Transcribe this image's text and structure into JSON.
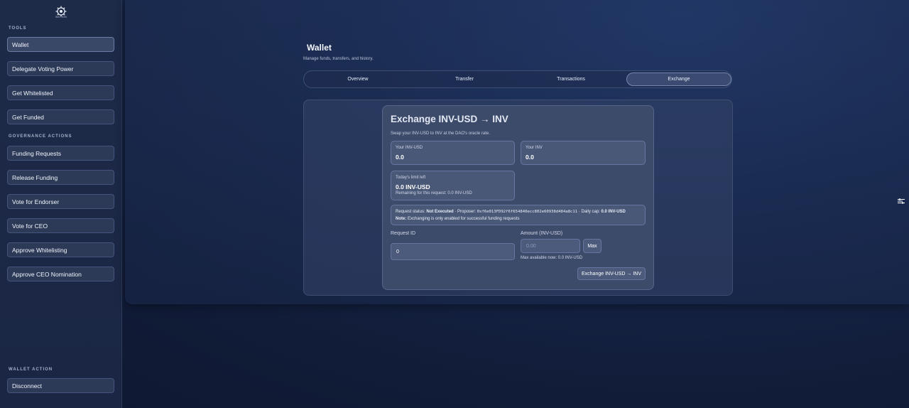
{
  "sidebar": {
    "logo_text": "INVTION",
    "tools_label": "TOOLS",
    "tools": [
      {
        "label": "Wallet",
        "active": true
      },
      {
        "label": "Delegate Voting Power"
      },
      {
        "label": "Get Whitelisted"
      },
      {
        "label": "Get Funded"
      }
    ],
    "gov_label": "GOVERNANCE ACTIONS",
    "gov": [
      {
        "label": "Funding Requests"
      },
      {
        "label": "Release Funding"
      },
      {
        "label": "Vote for Endorser"
      },
      {
        "label": "Vote for CEO"
      },
      {
        "label": "Approve Whitelisting"
      },
      {
        "label": "Approve CEO Nomination"
      }
    ],
    "wallet_label": "WALLET ACTION",
    "disconnect": "Disconnect"
  },
  "page": {
    "title": "Wallet",
    "subtitle": "Manage funds, transfers, and history."
  },
  "tabs": [
    {
      "label": "Overview"
    },
    {
      "label": "Transfer"
    },
    {
      "label": "Transactions"
    },
    {
      "label": "Exchange",
      "active": true
    }
  ],
  "exchange": {
    "title": "Exchange INV-USD → INV",
    "subtitle": "Swap your INV-USD to INV at the DAO's oracle rate.",
    "your_invusd_label": "Your INV-USD",
    "your_invusd_value": "0.0",
    "your_inv_label": "Your INV",
    "your_inv_value": "0.0",
    "limit_label": "Today's limit left",
    "limit_value": "0.0 INV-USD",
    "limit_note": "Remaining for this request: 0.0 INV-USD",
    "status": {
      "prefix": "Request status: ",
      "value": "Not Executed",
      "proposer_prefix": " · Proposer: ",
      "proposer": "0xf6e013FD92f6f654840ecc802e60938d484a8c11",
      "cap_prefix": " · Daily cap: ",
      "cap": "0.0 INV-USD",
      "note_label": "Note:",
      "note": " Exchanging is only enabled for successful funding requests"
    },
    "request_id_label": "Request ID",
    "request_id_value": "0",
    "amount_label": "Amount (INV-USD)",
    "amount_placeholder": "0.00",
    "max_button": "Max",
    "max_available": "Max available now: 0.0 INV-USD",
    "submit_button": "Exchange INV-USD → INV"
  },
  "colors": {
    "background": "#111c38",
    "sidebar": "#1d2a48",
    "card": "#3d4b6b",
    "accent_border": "#7586ae"
  }
}
